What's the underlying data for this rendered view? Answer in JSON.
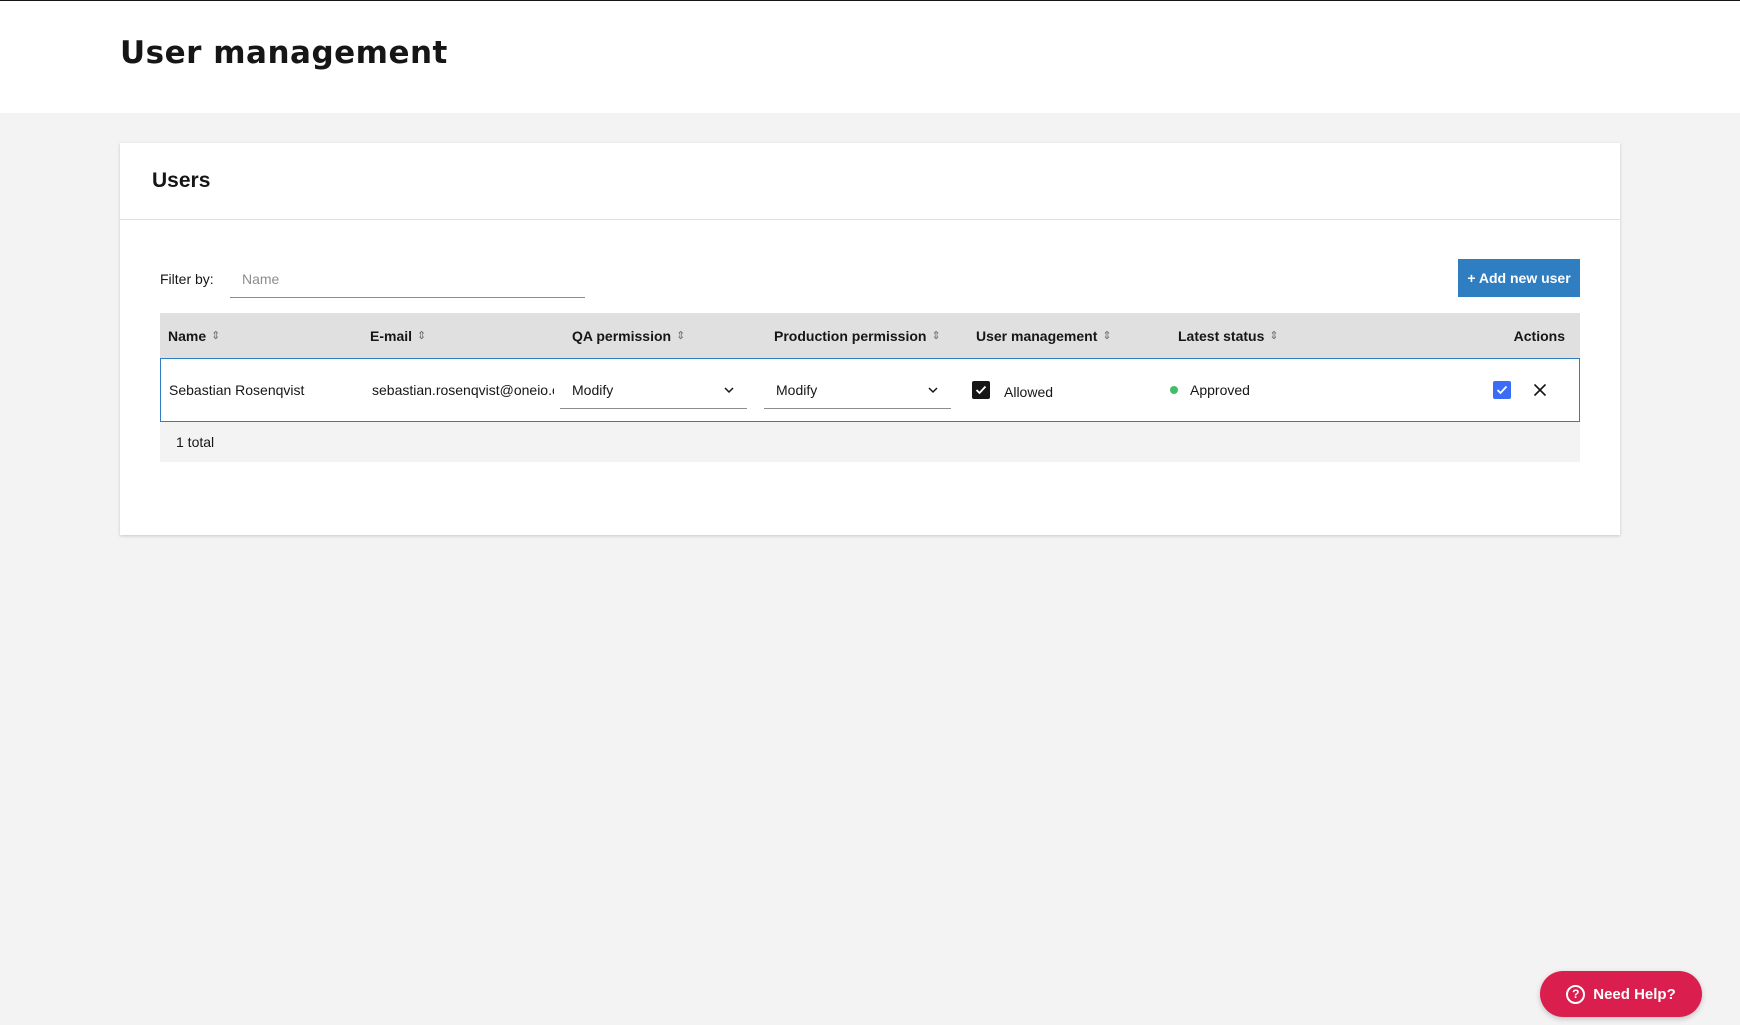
{
  "page": {
    "title": "User management"
  },
  "card": {
    "title": "Users"
  },
  "filter": {
    "label": "Filter by:",
    "placeholder": "Name",
    "value": ""
  },
  "toolbar": {
    "add_label": "+ Add new user"
  },
  "table": {
    "columns": {
      "name": "Name",
      "email": "E-mail",
      "qa": "QA permission",
      "prod": "Production permission",
      "um": "User management",
      "status": "Latest status",
      "actions": "Actions"
    },
    "rows": [
      {
        "name": "Sebastian Rosenqvist",
        "email": "sebastian.rosenqvist@oneio.clou",
        "qa_permission": "Modify",
        "prod_permission": "Modify",
        "user_management_checked": true,
        "user_management_label": "Allowed",
        "status": "Approved",
        "status_color": "#42be65"
      }
    ],
    "footer": "1 total"
  },
  "help": {
    "label": "Need Help?"
  },
  "colors": {
    "accent": "#2f7ec1",
    "help": "#da1e4e",
    "approve": "#3b6cf6"
  }
}
